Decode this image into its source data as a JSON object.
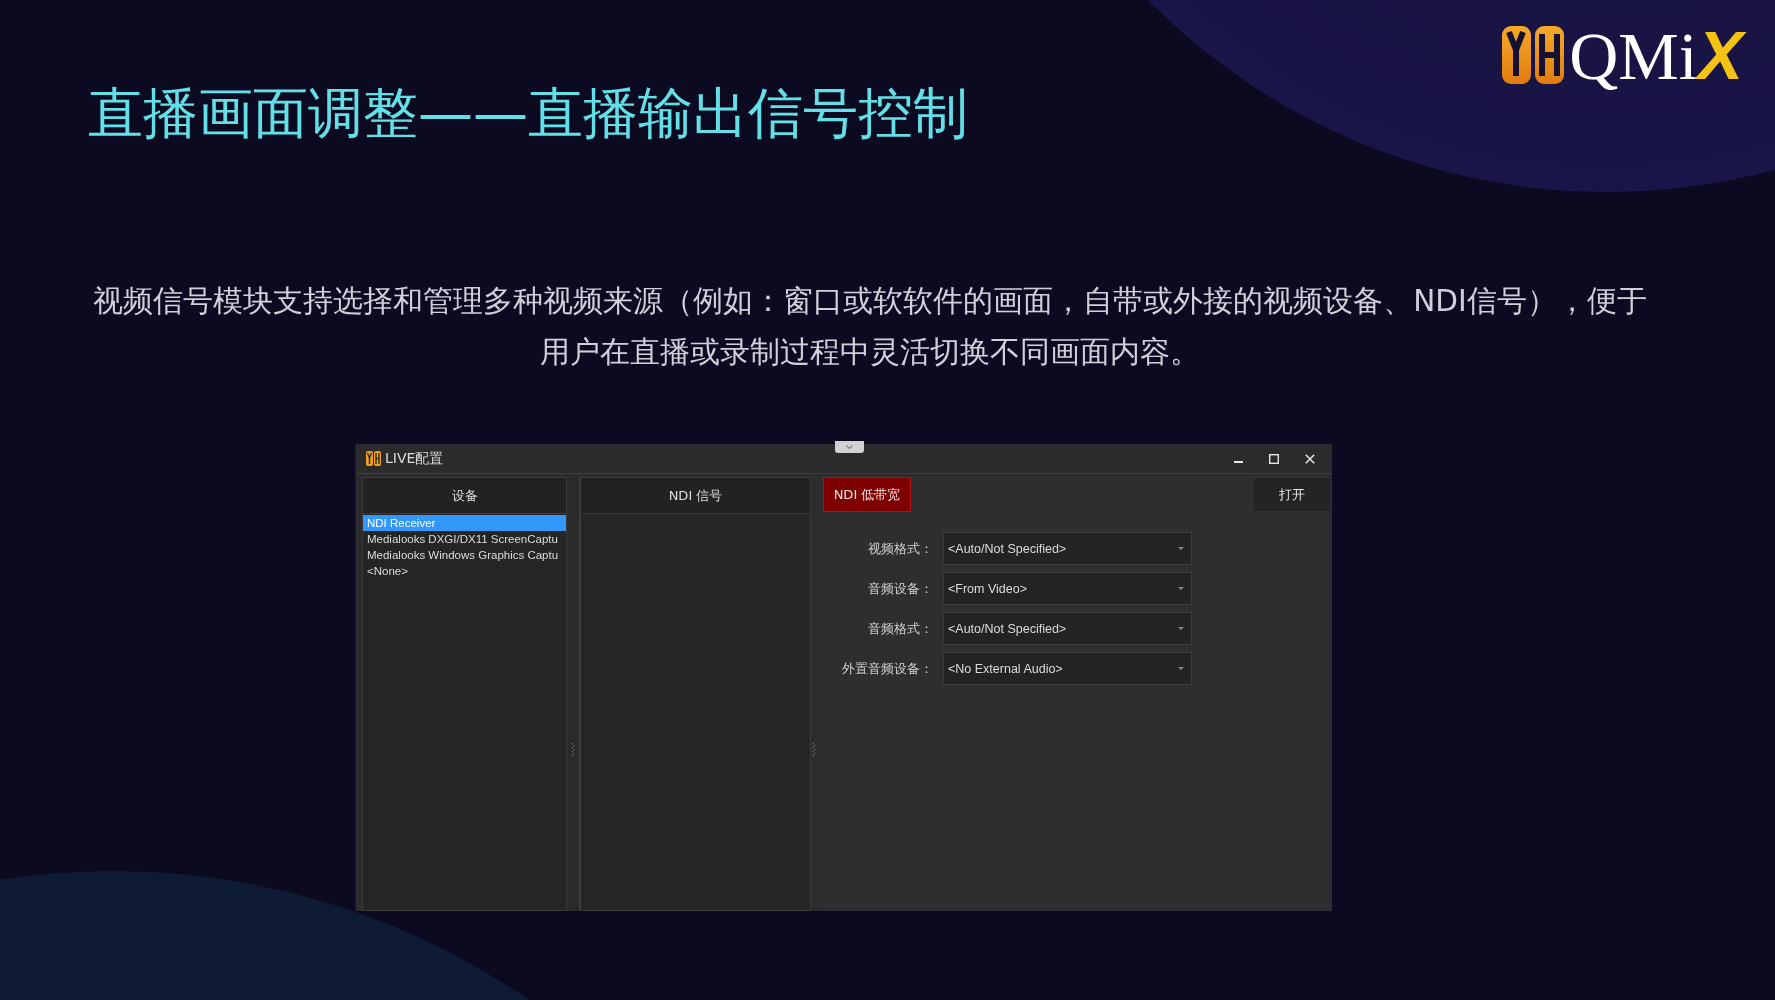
{
  "slide": {
    "title": "直播画面调整——直播输出信号控制",
    "description": {
      "lines": [
        "视频信号模块支持选择和管理多种视频来源（例如：窗口或软软件的画面，自带或外接的视频设备、NDI信号），便于",
        "用户在直播或录制过程中灵活切换不同画面内容。"
      ]
    }
  },
  "logo": {
    "word": "QMi",
    "accent": "X"
  },
  "window": {
    "title": "LIVE配置",
    "device_panel": {
      "header": "设备",
      "items": [
        {
          "label": "NDI Receiver",
          "selected": true
        },
        {
          "label": "Medialooks DXGI/DX11 ScreenCaptu",
          "selected": false
        },
        {
          "label": "Medialooks Windows Graphics Captu",
          "selected": false
        },
        {
          "label": "<None>",
          "selected": false
        }
      ]
    },
    "signal_panel": {
      "header": "NDI 信号"
    },
    "low_bandwidth_button": {
      "label": "NDI 低带宽",
      "on": true
    },
    "open_button": {
      "label": "打开"
    },
    "fields": [
      {
        "label": "视频格式：",
        "value": "<Auto/Not Specified>"
      },
      {
        "label": "音频设备：",
        "value": "<From Video>"
      },
      {
        "label": "音频格式：",
        "value": "<Auto/Not Specified>"
      },
      {
        "label": "外置音频设备：",
        "value": "<No External Audio>"
      }
    ]
  }
}
